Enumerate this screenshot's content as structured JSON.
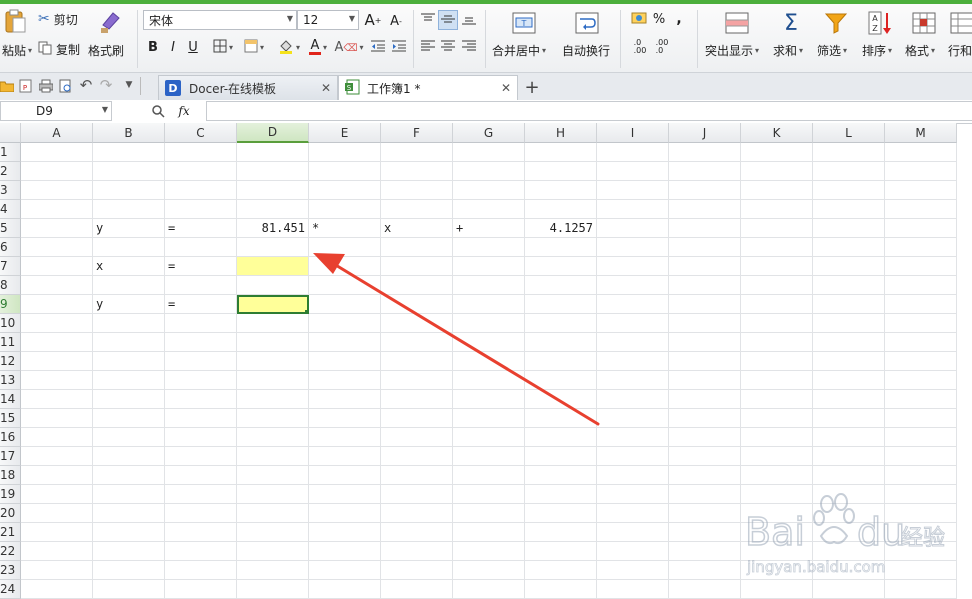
{
  "ribbon": {
    "paste": "粘贴",
    "cut": "剪切",
    "copy": "复制",
    "format_painter": "格式刷",
    "font_name": "宋体",
    "font_size": "12",
    "bold": "B",
    "italic": "I",
    "underline": "U",
    "grow_font": "A",
    "shrink_font": "A",
    "merge_center": "合并居中",
    "wrap_text": "自动换行",
    "percent": "%",
    "comma": ",",
    "conditional": "突出显示",
    "sum": "求和",
    "filter": "筛选",
    "sort": "排序",
    "format": "格式",
    "rows_cols": "行和"
  },
  "tabs": [
    {
      "label": "Docer-在线模板",
      "active": false
    },
    {
      "label": "工作簿1 *",
      "active": true
    }
  ],
  "namebox": "D9",
  "fx": "fx",
  "columns": [
    "A",
    "B",
    "C",
    "D",
    "E",
    "F",
    "G",
    "H",
    "I",
    "J",
    "K",
    "L",
    "M"
  ],
  "rows": [
    "1",
    "2",
    "3",
    "4",
    "5",
    "6",
    "7",
    "8",
    "9",
    "10",
    "11",
    "12",
    "13",
    "14",
    "15",
    "16",
    "17",
    "18",
    "19",
    "20",
    "21",
    "22",
    "23",
    "24"
  ],
  "cells": {
    "B5": "y",
    "C5": "=",
    "D5": "81.451",
    "E5": "*",
    "F5": "x",
    "G5": "+",
    "H5": "4.1257",
    "B7": "x",
    "C7": "=",
    "B9": "y",
    "C9": "="
  },
  "watermark": {
    "brand": "Bai",
    "brand2": "du",
    "cn": "经验",
    "url": "jingyan.baidu.com"
  },
  "colors": {
    "highlight": "#ffff99",
    "selection": "#2e7d32",
    "accent_green": "#4caf3c",
    "arrow": "#e8402f"
  }
}
